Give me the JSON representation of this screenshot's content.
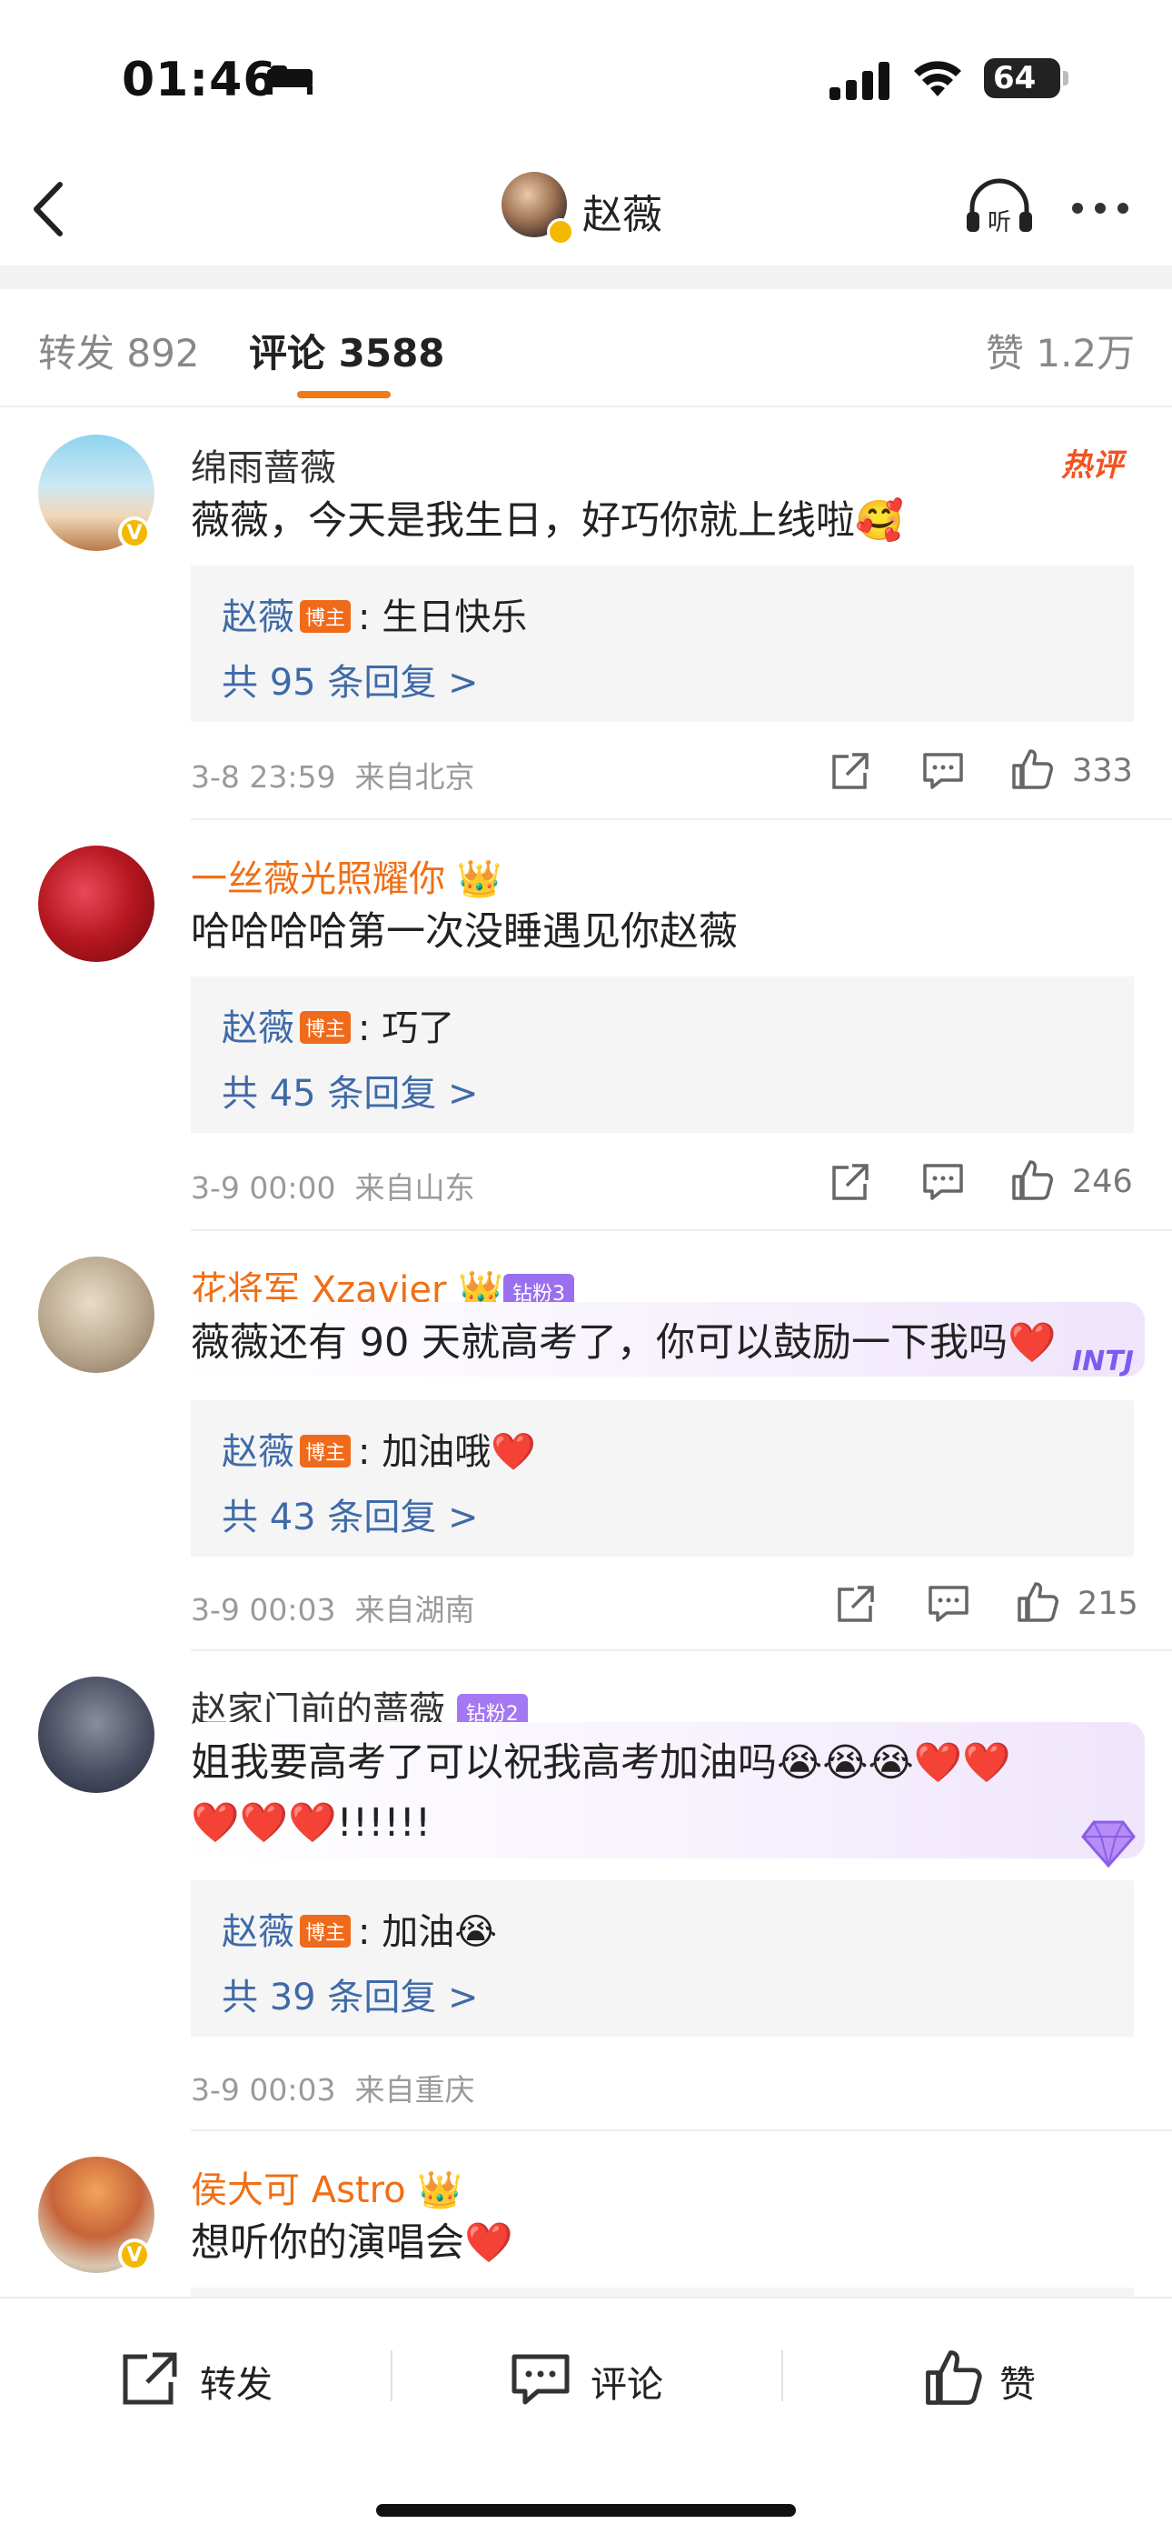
{
  "status": {
    "time": "01:46",
    "battery": "64"
  },
  "nav": {
    "title": "赵薇"
  },
  "tabs": [
    {
      "label": "转发 892"
    },
    {
      "label": "评论 3588"
    },
    {
      "label": "赞 1.2万"
    }
  ],
  "hot_label": "热评",
  "comments": [
    {
      "user": "绵雨蔷薇",
      "text": "薇薇，今天是我生日，好巧你就上线啦",
      "text_emoji": "🥰",
      "reply_author": "赵薇",
      "reply_badge": "博主",
      "reply_text": "生日快乐",
      "reply_count": "共 95 条回复 >",
      "time": "3-8 23:59",
      "location": "来自北京",
      "likes": "333"
    },
    {
      "user": "一丝薇光照耀你",
      "text": "哈哈哈哈第一次没睡遇见你赵薇",
      "reply_author": "赵薇",
      "reply_badge": "博主",
      "reply_text": "巧了",
      "reply_count": "共 45 条回复 >",
      "time": "3-9 00:00",
      "location": "来自山东",
      "likes": "246"
    },
    {
      "user": "花将军 Xzavier",
      "fan_badge": "钻粉3",
      "text": "薇薇还有 90 天就高考了，你可以鼓励一下我吗",
      "text_emoji": "❤️",
      "card_tag": "INTJ",
      "reply_author": "赵薇",
      "reply_badge": "博主",
      "reply_text": "加油哦",
      "reply_emoji": "❤️",
      "reply_count": "共 43 条回复 >",
      "time": "3-9 00:03",
      "location": "来自湖南",
      "likes": "215"
    },
    {
      "user": "赵家门前的蔷薇",
      "fan_badge": "钻粉2",
      "text_line1": "姐我要高考了可以祝我高考加油吗",
      "text_emoji1": "😭😭😭❤️❤️",
      "text_emoji2": "❤️❤️❤️",
      "text_line2": "!!!!!!",
      "reply_author": "赵薇",
      "reply_badge": "博主",
      "reply_text": "加油",
      "reply_emoji": "😭",
      "reply_count": "共 39 条回复 >",
      "time": "3-9 00:03",
      "location": "来自重庆"
    },
    {
      "user": "侯大可 Astro",
      "text": "想听你的演唱会",
      "text_emoji": "❤️"
    }
  ],
  "bottom_bar": {
    "repost": "转发",
    "comment": "评论",
    "like": "赞"
  },
  "colors": {
    "accent": "#f27a18",
    "link": "#3f6aa8",
    "vip_name": "#f06f16"
  }
}
